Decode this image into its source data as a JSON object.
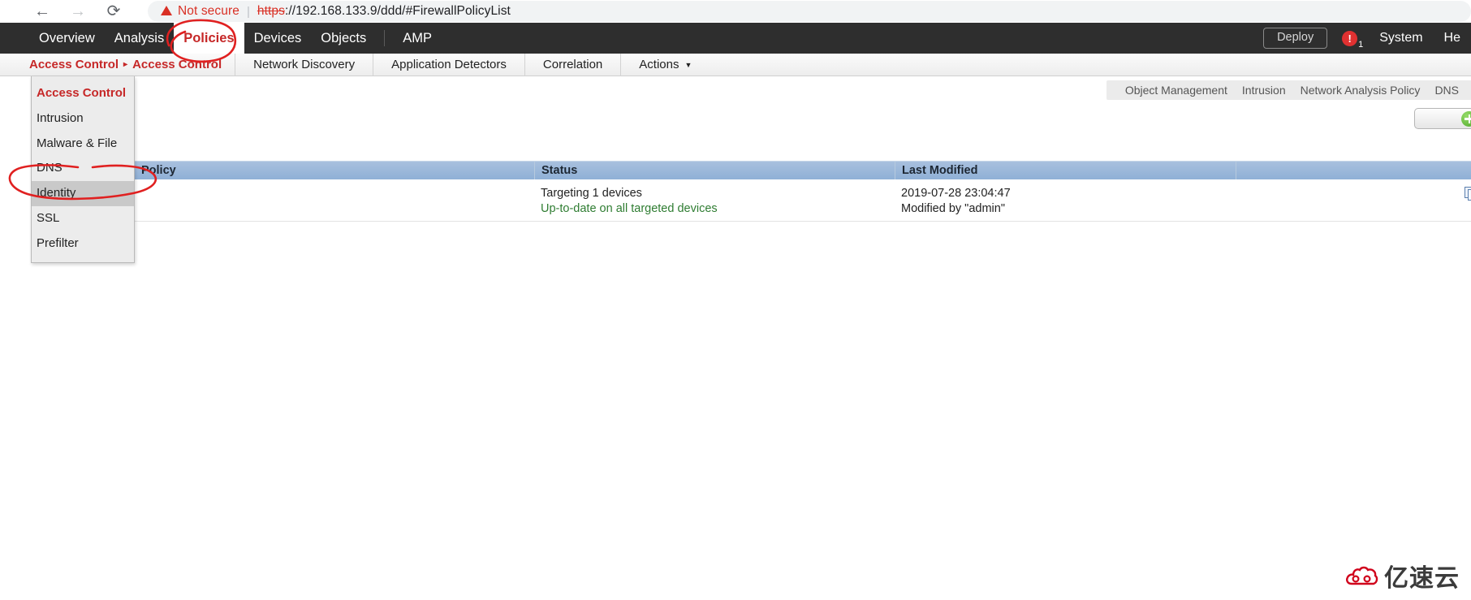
{
  "browser": {
    "back_icon": "arrow-left-icon",
    "forward_icon": "arrow-right-icon",
    "reload_icon": "reload-icon",
    "security_label": "Not secure",
    "separator": "|",
    "url_scheme": "https",
    "url_rest": "://192.168.133.9/ddd/#FirewallPolicyList"
  },
  "topnav": {
    "items": [
      {
        "label": "Overview",
        "active": false
      },
      {
        "label": "Analysis",
        "active": false
      },
      {
        "label": "Policies",
        "active": true
      },
      {
        "label": "Devices",
        "active": false
      },
      {
        "label": "Objects",
        "active": false
      },
      {
        "label": "AMP",
        "active": false
      }
    ],
    "deploy_label": "Deploy",
    "alert_glyph": "!",
    "alert_count": "1",
    "system_label": "System",
    "help_label": "He"
  },
  "subnav": {
    "breadcrumb_parent": "Access Control",
    "breadcrumb_arrow": "▸",
    "breadcrumb_current": "Access Control",
    "items": [
      {
        "label": "Network Discovery",
        "caret": false
      },
      {
        "label": "Application Detectors",
        "caret": false
      },
      {
        "label": "Correlation",
        "caret": false
      },
      {
        "label": "Actions",
        "caret": true
      }
    ],
    "caret_glyph": "▼"
  },
  "dropdown": {
    "items": [
      {
        "label": "Access Control",
        "head": true,
        "hover": false
      },
      {
        "label": "Intrusion",
        "head": false,
        "hover": false
      },
      {
        "label": "Malware & File",
        "head": false,
        "hover": false
      },
      {
        "label": "DNS",
        "head": false,
        "hover": false
      },
      {
        "label": "Identity",
        "head": false,
        "hover": true
      },
      {
        "label": "SSL",
        "head": false,
        "hover": false
      },
      {
        "label": "Prefilter",
        "head": false,
        "hover": false
      }
    ]
  },
  "utilbar": {
    "items": [
      "Object Management",
      "Intrusion",
      "Network Analysis Policy",
      "DNS"
    ]
  },
  "newpolicy": {
    "icon": "plus-circle-icon"
  },
  "table": {
    "headers": {
      "policy": "Policy",
      "status": "Status",
      "last_modified": "Last Modified"
    },
    "rows": [
      {
        "policy": "",
        "status_line1": "Targeting 1 devices",
        "status_line2": "Up-to-date on all targeted devices",
        "modified_line1": "2019-07-28 23:04:47",
        "modified_line2": "Modified by \"admin\"",
        "action_icon": "copy-icon"
      }
    ]
  },
  "annotations": {
    "policies_circle": "hand-drawn-red-ellipse-around-policies-tab",
    "identity_circle": "hand-drawn-red-ellipse-around-identity-menu-item"
  },
  "watermark": {
    "text": "亿速云",
    "logo": "cloud-logo-icon",
    "color": "#d0021b"
  },
  "colors": {
    "topnav_bg": "#2e2e2e",
    "accent_red": "#c62828",
    "table_header": "#8fb0d6",
    "status_green": "#2f7d32",
    "annotation_red": "#e02020"
  }
}
